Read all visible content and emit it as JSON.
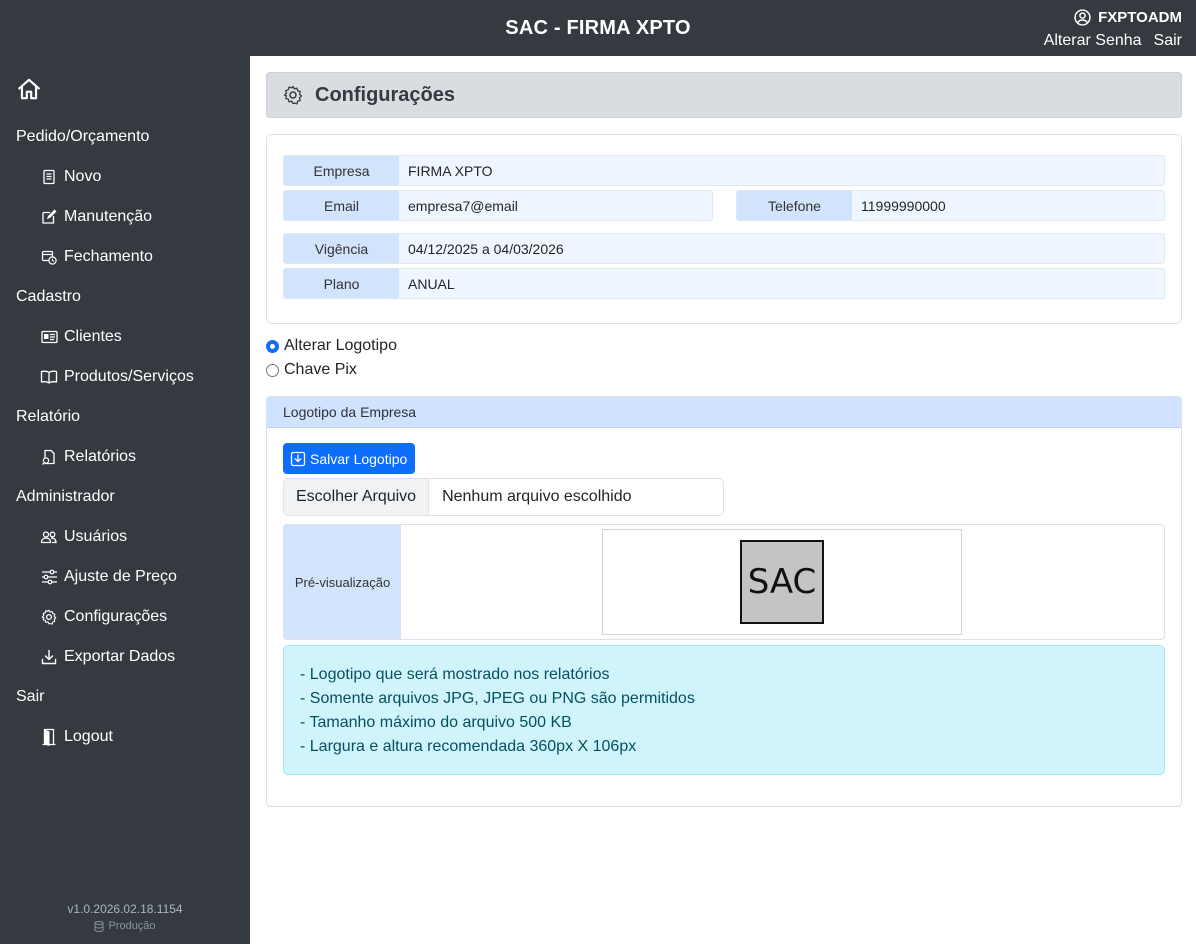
{
  "header": {
    "title": "SAC - FIRMA XPTO",
    "user": "FXPTOADM",
    "change_password": "Alterar Senha",
    "exit": "Sair"
  },
  "sidebar": {
    "sections": [
      {
        "label": "Pedido/Orçamento",
        "items": [
          {
            "label": "Novo",
            "icon": "document-icon"
          },
          {
            "label": "Manutenção",
            "icon": "edit-icon"
          },
          {
            "label": "Fechamento",
            "icon": "calendar-clock-icon"
          }
        ]
      },
      {
        "label": "Cadastro",
        "items": [
          {
            "label": "Clientes",
            "icon": "id-card-icon"
          },
          {
            "label": "Produtos/Serviços",
            "icon": "book-icon"
          }
        ]
      },
      {
        "label": "Relatório",
        "items": [
          {
            "label": "Relatórios",
            "icon": "report-icon"
          }
        ]
      },
      {
        "label": "Administrador",
        "items": [
          {
            "label": "Usuários",
            "icon": "users-icon"
          },
          {
            "label": "Ajuste de Preço",
            "icon": "sliders-icon"
          },
          {
            "label": "Configurações",
            "icon": "gear-icon"
          },
          {
            "label": "Exportar Dados",
            "icon": "download-icon"
          }
        ]
      },
      {
        "label": "Sair",
        "items": [
          {
            "label": "Logout",
            "icon": "door-icon"
          }
        ]
      }
    ],
    "version": "v1.0.2026.02.18.1154",
    "environment": "Produção"
  },
  "page": {
    "title": "Configurações"
  },
  "company": {
    "empresa_label": "Empresa",
    "empresa_value": "FIRMA XPTO",
    "email_label": "Email",
    "email_value": "empresa7@email",
    "telefone_label": "Telefone",
    "telefone_value": "11999990000",
    "vigencia_label": "Vigência",
    "vigencia_value": "04/12/2025 a 04/03/2026",
    "plano_label": "Plano",
    "plano_value": "ANUAL"
  },
  "options": {
    "alterar_logotipo": "Alterar Logotipo",
    "chave_pix": "Chave Pix",
    "selected": "alterar_logotipo"
  },
  "logo_panel": {
    "title": "Logotipo da Empresa",
    "save_button": "Salvar Logotipo",
    "choose_file": "Escolher Arquivo",
    "no_file": "Nenhum arquivo escolhido",
    "preview_label": "Pré-visualização",
    "preview_logo_text": "SAC",
    "info": [
      "- Logotipo que será mostrado nos relatórios",
      "- Somente arquivos JPG, JPEG ou PNG são permitidos",
      "- Tamanho máximo do arquivo 500 KB",
      "- Largura e altura recomendada 360px X 106px"
    ]
  },
  "colors": {
    "sidebar_bg": "#343a40",
    "primary": "#0d6efd",
    "label_bg": "#d2e3fc",
    "info_bg": "#cff4fc"
  }
}
